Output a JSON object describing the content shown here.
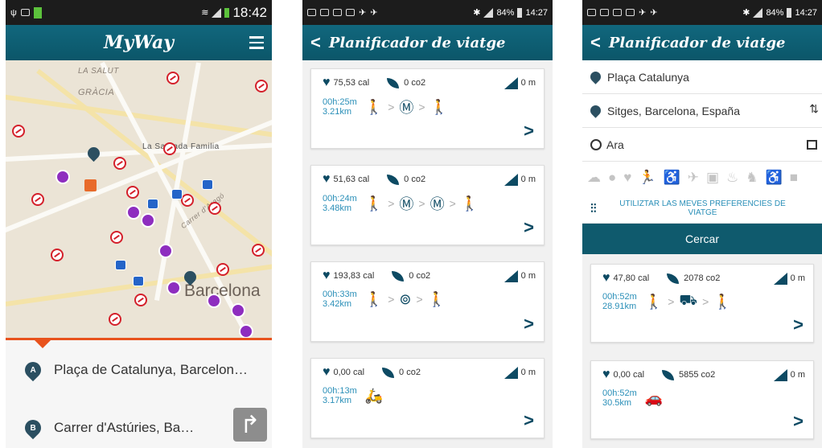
{
  "phone1": {
    "status_time": "18:42",
    "app_title": "MyWay",
    "map": {
      "labels": {
        "la_salut": "LA SALUT",
        "gracia": "GRÀCIA",
        "sagrada": "La Sagrada Familia",
        "aragon": "Carrer d'Aragó",
        "city": "Barcelona"
      }
    },
    "route": {
      "origin_badge": "A",
      "origin": "Plaça de Catalunya, Barcelon…",
      "destination_badge": "B",
      "destination": "Carrer d'Astúries, Ba…"
    }
  },
  "phone2": {
    "status_time": "14:27",
    "status_battery": "84%",
    "title": "Planificador de viatge",
    "cards": [
      {
        "calories": "75,53 cal",
        "co2": "0 co2",
        "slope": "0 m",
        "time": "00h:25m",
        "distance": "3.21km",
        "legs": [
          "walk",
          "metro",
          "walk"
        ]
      },
      {
        "calories": "51,63 cal",
        "co2": "0 co2",
        "slope": "0 m",
        "time": "00h:24m",
        "distance": "3.48km",
        "legs": [
          "walk",
          "metro",
          "metro",
          "walk"
        ]
      },
      {
        "calories": "193,83 cal",
        "co2": "0 co2",
        "slope": "0 m",
        "time": "00h:33m",
        "distance": "3.42km",
        "legs": [
          "walk",
          "bicing",
          "walk"
        ]
      },
      {
        "calories": "0,00 cal",
        "co2": "0 co2",
        "slope": "0 m",
        "time": "00h:13m",
        "distance": "3.17km",
        "legs": [
          "motorbike"
        ]
      }
    ]
  },
  "phone3": {
    "status_time": "14:27",
    "status_battery": "84%",
    "title": "Planificador de viatge",
    "origin": "Plaça Catalunya",
    "destination": "Sitges, Barcelona, España",
    "departure": "Ara",
    "preferences_link": "UTILIZTAR LAS MEVES PREFERENCIES DE VIATGE",
    "search_button": "Cercar",
    "cards": [
      {
        "calories": "47,80 cal",
        "co2": "2078 co2",
        "slope": "0 m",
        "time": "00h:52m",
        "distance": "28.91km",
        "legs": [
          "walk",
          "bus",
          "walk"
        ]
      },
      {
        "calories": "0,00 cal",
        "co2": "5855 co2",
        "slope": "0 m",
        "time": "00h:52m",
        "distance": "30.5km",
        "legs": [
          "car"
        ]
      }
    ]
  },
  "colors": {
    "appbar": "#0e5e73",
    "accent_orange": "#e8521c",
    "time_blue": "#2a8fb8",
    "icon_dark": "#0d4a63"
  }
}
